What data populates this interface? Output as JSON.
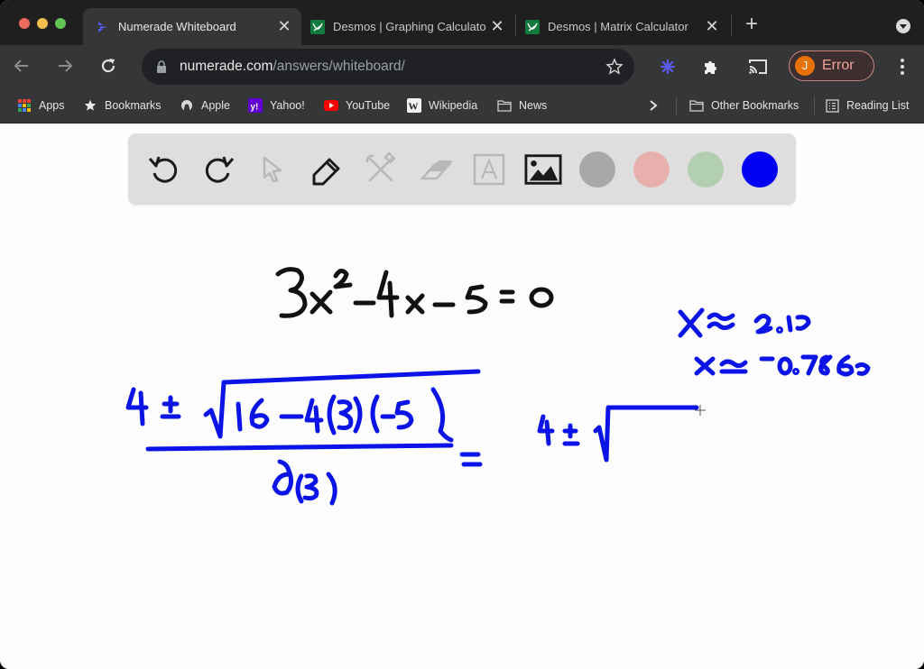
{
  "browser": {
    "tabs": [
      {
        "title": "Numerade Whiteboard",
        "favicon": "numerade-logo-icon",
        "active": true
      },
      {
        "title": "Desmos | Graphing Calculator",
        "favicon": "desmos-logo-icon",
        "active": false
      },
      {
        "title": "Desmos | Matrix Calculator",
        "favicon": "desmos-logo-icon",
        "active": false
      }
    ],
    "address": {
      "domain": "numerade.com",
      "path": "/answers/whiteboard/"
    },
    "profile": {
      "initial": "J",
      "status": "Error"
    },
    "bookmarks": [
      {
        "label": "Apps",
        "icon": "apps-grid-icon"
      },
      {
        "label": "Bookmarks",
        "icon": "star-icon"
      },
      {
        "label": "Apple",
        "icon": "apple-icon"
      },
      {
        "label": "Yahoo!",
        "icon": "yahoo-icon"
      },
      {
        "label": "YouTube",
        "icon": "youtube-icon"
      },
      {
        "label": "Wikipedia",
        "icon": "wikipedia-icon"
      },
      {
        "label": "News",
        "icon": "folder-icon"
      }
    ],
    "other_bookmarks": "Other Bookmarks",
    "reading_list": "Reading List"
  },
  "whiteboard": {
    "tools": [
      {
        "name": "undo",
        "enabled": true
      },
      {
        "name": "redo",
        "enabled": true
      },
      {
        "name": "select",
        "enabled": false
      },
      {
        "name": "pen",
        "enabled": true
      },
      {
        "name": "tools",
        "enabled": false
      },
      {
        "name": "eraser",
        "enabled": false
      },
      {
        "name": "text",
        "enabled": false
      },
      {
        "name": "image",
        "enabled": true
      }
    ],
    "colors": [
      {
        "name": "gray",
        "hex": "#a8a8a8",
        "selected": false
      },
      {
        "name": "pink",
        "hex": "#e8b0ad",
        "selected": false
      },
      {
        "name": "green",
        "hex": "#b2cfb2",
        "selected": false
      },
      {
        "name": "blue",
        "hex": "#0000f5",
        "selected": true
      }
    ],
    "ink": {
      "black": "#111111",
      "blue": "#0a14e6"
    },
    "handwriting": {
      "equation": "3x^2 - 4x - 5 = 0",
      "quadratic_numerator": "4 ± √(16 - 4(3)(-5))",
      "quadratic_denominator": "2(3)",
      "equals": "=",
      "continuation": "4 ± √",
      "root_1": "x ≈ 2.12",
      "root_2": "x ≈ -0.786"
    }
  }
}
